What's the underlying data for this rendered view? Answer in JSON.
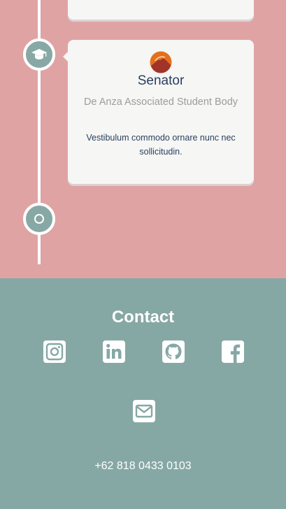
{
  "experience": {
    "card": {
      "title": "Senator",
      "organization": "De Anza Associated Student Body",
      "description": "Vestibulum commodo ornare nunc nec sollicitudin.",
      "icon": "graduation-cap-icon"
    }
  },
  "contact": {
    "title": "Contact",
    "phone": "+62 818 0433 0103",
    "links": [
      {
        "icon": "instagram-icon"
      },
      {
        "icon": "linkedin-icon"
      },
      {
        "icon": "github-icon"
      },
      {
        "icon": "facebook-icon"
      },
      {
        "icon": "email-icon"
      }
    ]
  },
  "colors": {
    "timeline_background": "#e0a3a4",
    "contact_background": "#86a8a5",
    "node_fill": "#88a8a5",
    "card_background": "#f6f6f5",
    "title_text": "#2a3f5e",
    "muted_text": "#9c9c9c"
  }
}
